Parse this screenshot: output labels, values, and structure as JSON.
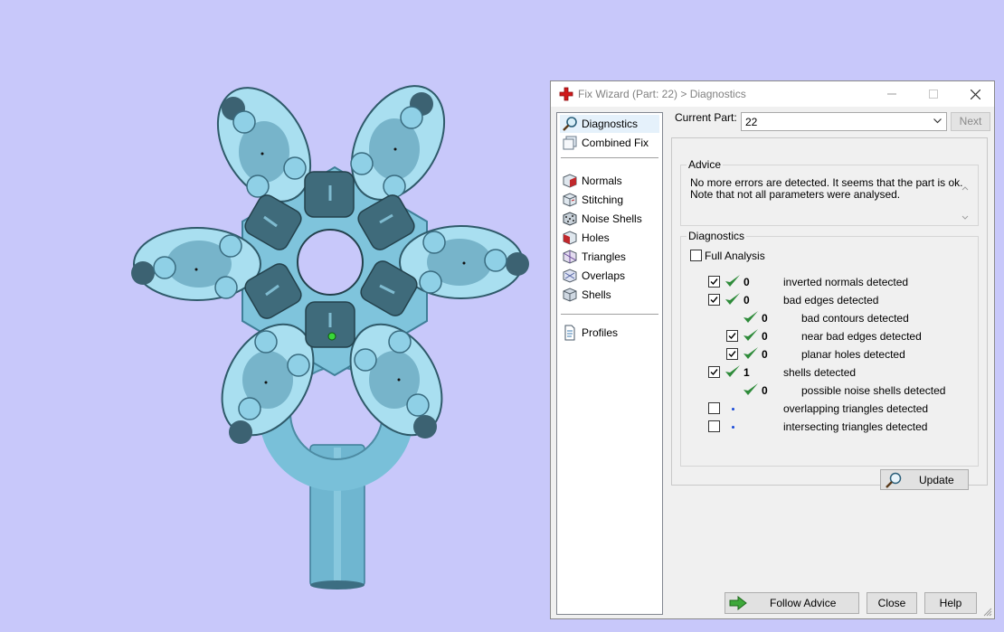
{
  "window": {
    "title": "Fix Wizard (Part: 22) > Diagnostics",
    "title_icon": "red-cross-icon",
    "minimize_icon": "minimize-icon",
    "maximize_icon": "maximize-icon",
    "close_icon": "close-icon"
  },
  "nav": {
    "items": [
      {
        "label": "Diagnostics",
        "icon": "magnifier-icon",
        "selected": true
      },
      {
        "label": "Combined Fix",
        "icon": "stack-icon"
      },
      {
        "label": "Normals",
        "icon": "normals-cube-icon"
      },
      {
        "label": "Stitching",
        "icon": "stitching-cube-icon"
      },
      {
        "label": "Noise Shells",
        "icon": "noise-shells-cube-icon"
      },
      {
        "label": "Holes",
        "icon": "holes-cube-icon"
      },
      {
        "label": "Triangles",
        "icon": "triangles-cube-icon"
      },
      {
        "label": "Overlaps",
        "icon": "overlaps-cube-icon"
      },
      {
        "label": "Shells",
        "icon": "shells-cube-icon"
      },
      {
        "label": "Profiles",
        "icon": "document-icon"
      }
    ]
  },
  "current_part": {
    "label": "Current Part:",
    "value": "22"
  },
  "next_button": {
    "label": "Next",
    "enabled": false
  },
  "advice": {
    "title": "Advice",
    "line1": "No more errors are detected. It seems that the part is ok.",
    "line2": "Note that not all parameters were analysed."
  },
  "diagnostics": {
    "title": "Diagnostics",
    "full_analysis": {
      "label": "Full Analysis",
      "checked": false
    },
    "rows": [
      {
        "checked": true,
        "status": "ok",
        "count": "0",
        "label": "inverted normals detected"
      },
      {
        "checked": true,
        "status": "ok",
        "count": "0",
        "label": "bad edges detected"
      },
      {
        "checked": null,
        "status": "ok",
        "count": "0",
        "label": "bad contours detected"
      },
      {
        "checked": true,
        "status": "ok",
        "count": "0",
        "label": "near bad edges detected"
      },
      {
        "checked": true,
        "status": "ok",
        "count": "0",
        "label": "planar holes detected"
      },
      {
        "checked": true,
        "status": "ok",
        "count": "1",
        "label": "shells detected"
      },
      {
        "checked": null,
        "status": "ok",
        "count": "0",
        "label": "possible noise shells detected"
      },
      {
        "checked": false,
        "status": "not-analysed",
        "count": "",
        "label": "overlapping triangles detected"
      },
      {
        "checked": false,
        "status": "not-analysed",
        "count": "",
        "label": "intersecting triangles detected"
      }
    ],
    "update_label": "Update"
  },
  "buttons": {
    "follow_advice": "Follow Advice",
    "close": "Close",
    "help": "Help"
  },
  "colors": {
    "viewport_background": "#c8c8fa",
    "model": "#7fc4dc",
    "check_green": "#2e8b3a",
    "selection": "#e5f1fb"
  }
}
